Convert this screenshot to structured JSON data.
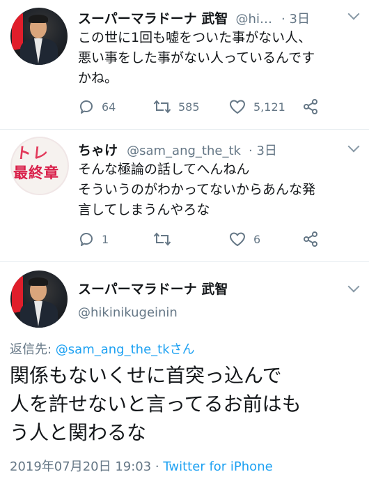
{
  "tweets": [
    {
      "display_name": "スーパーマラドーナ 武智",
      "handle": "@hi…",
      "time": "· 3日",
      "text": "この世に1回も嘘をついた事がない人、\n悪い事をした事がない人っているんです\nかね。",
      "reply_count": "64",
      "retweet_count": "585",
      "like_count": "5,121"
    },
    {
      "display_name": "ちゃけ",
      "handle": "@sam_ang_the_tk",
      "time": "· 3日",
      "text": "そんな極論の話してへんねん\nそういうのがわかってないからあんな発\n言してしまうんやろな",
      "avatar_text_1": "トレ",
      "avatar_text_2": "最終章",
      "reply_count": "1",
      "retweet_count": "",
      "like_count": "6"
    }
  ],
  "focused": {
    "display_name": "スーパーマラドーナ 武智",
    "handle": "@hikinikugeinin",
    "reply_prefix": "返信先: ",
    "reply_handle": "@sam_ang_the_tk",
    "reply_suffix": "さん",
    "text": "関係もないくせに首突っ込んで\n人を許せないと言ってるお前はも\nう人と関わるな",
    "timestamp": "2019年07月20日 19:03 · ",
    "client": "Twitter for iPhone"
  },
  "icons": {
    "reply": "reply-icon",
    "retweet": "retweet-icon",
    "like": "heart-icon",
    "share": "share-icon",
    "menu": "chevron-down-icon"
  },
  "colors": {
    "text": "#14171a",
    "secondary": "#657786",
    "link": "#1da1f2",
    "divider": "#e6ecf0"
  }
}
